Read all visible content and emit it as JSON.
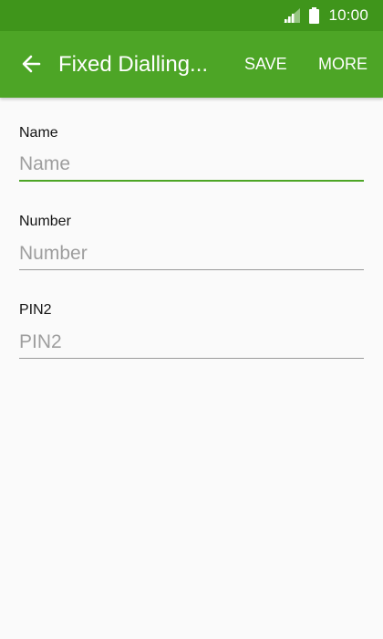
{
  "status_bar": {
    "time": "10:00",
    "icons": [
      "signal-icon",
      "battery-icon"
    ]
  },
  "app_bar": {
    "back_icon": "back-arrow-icon",
    "title": "Fixed Dialling...",
    "actions": {
      "save_label": "SAVE",
      "more_label": "MORE"
    }
  },
  "form": {
    "name": {
      "label": "Name",
      "value": "",
      "placeholder": "Name"
    },
    "number": {
      "label": "Number",
      "value": "",
      "placeholder": "Number"
    },
    "pin2": {
      "label": "PIN2",
      "value": "",
      "placeholder": "PIN2"
    }
  },
  "colors": {
    "status_bar": "#3f951b",
    "app_bar": "#4da526",
    "accent": "#4da526",
    "background": "#fafafa"
  }
}
